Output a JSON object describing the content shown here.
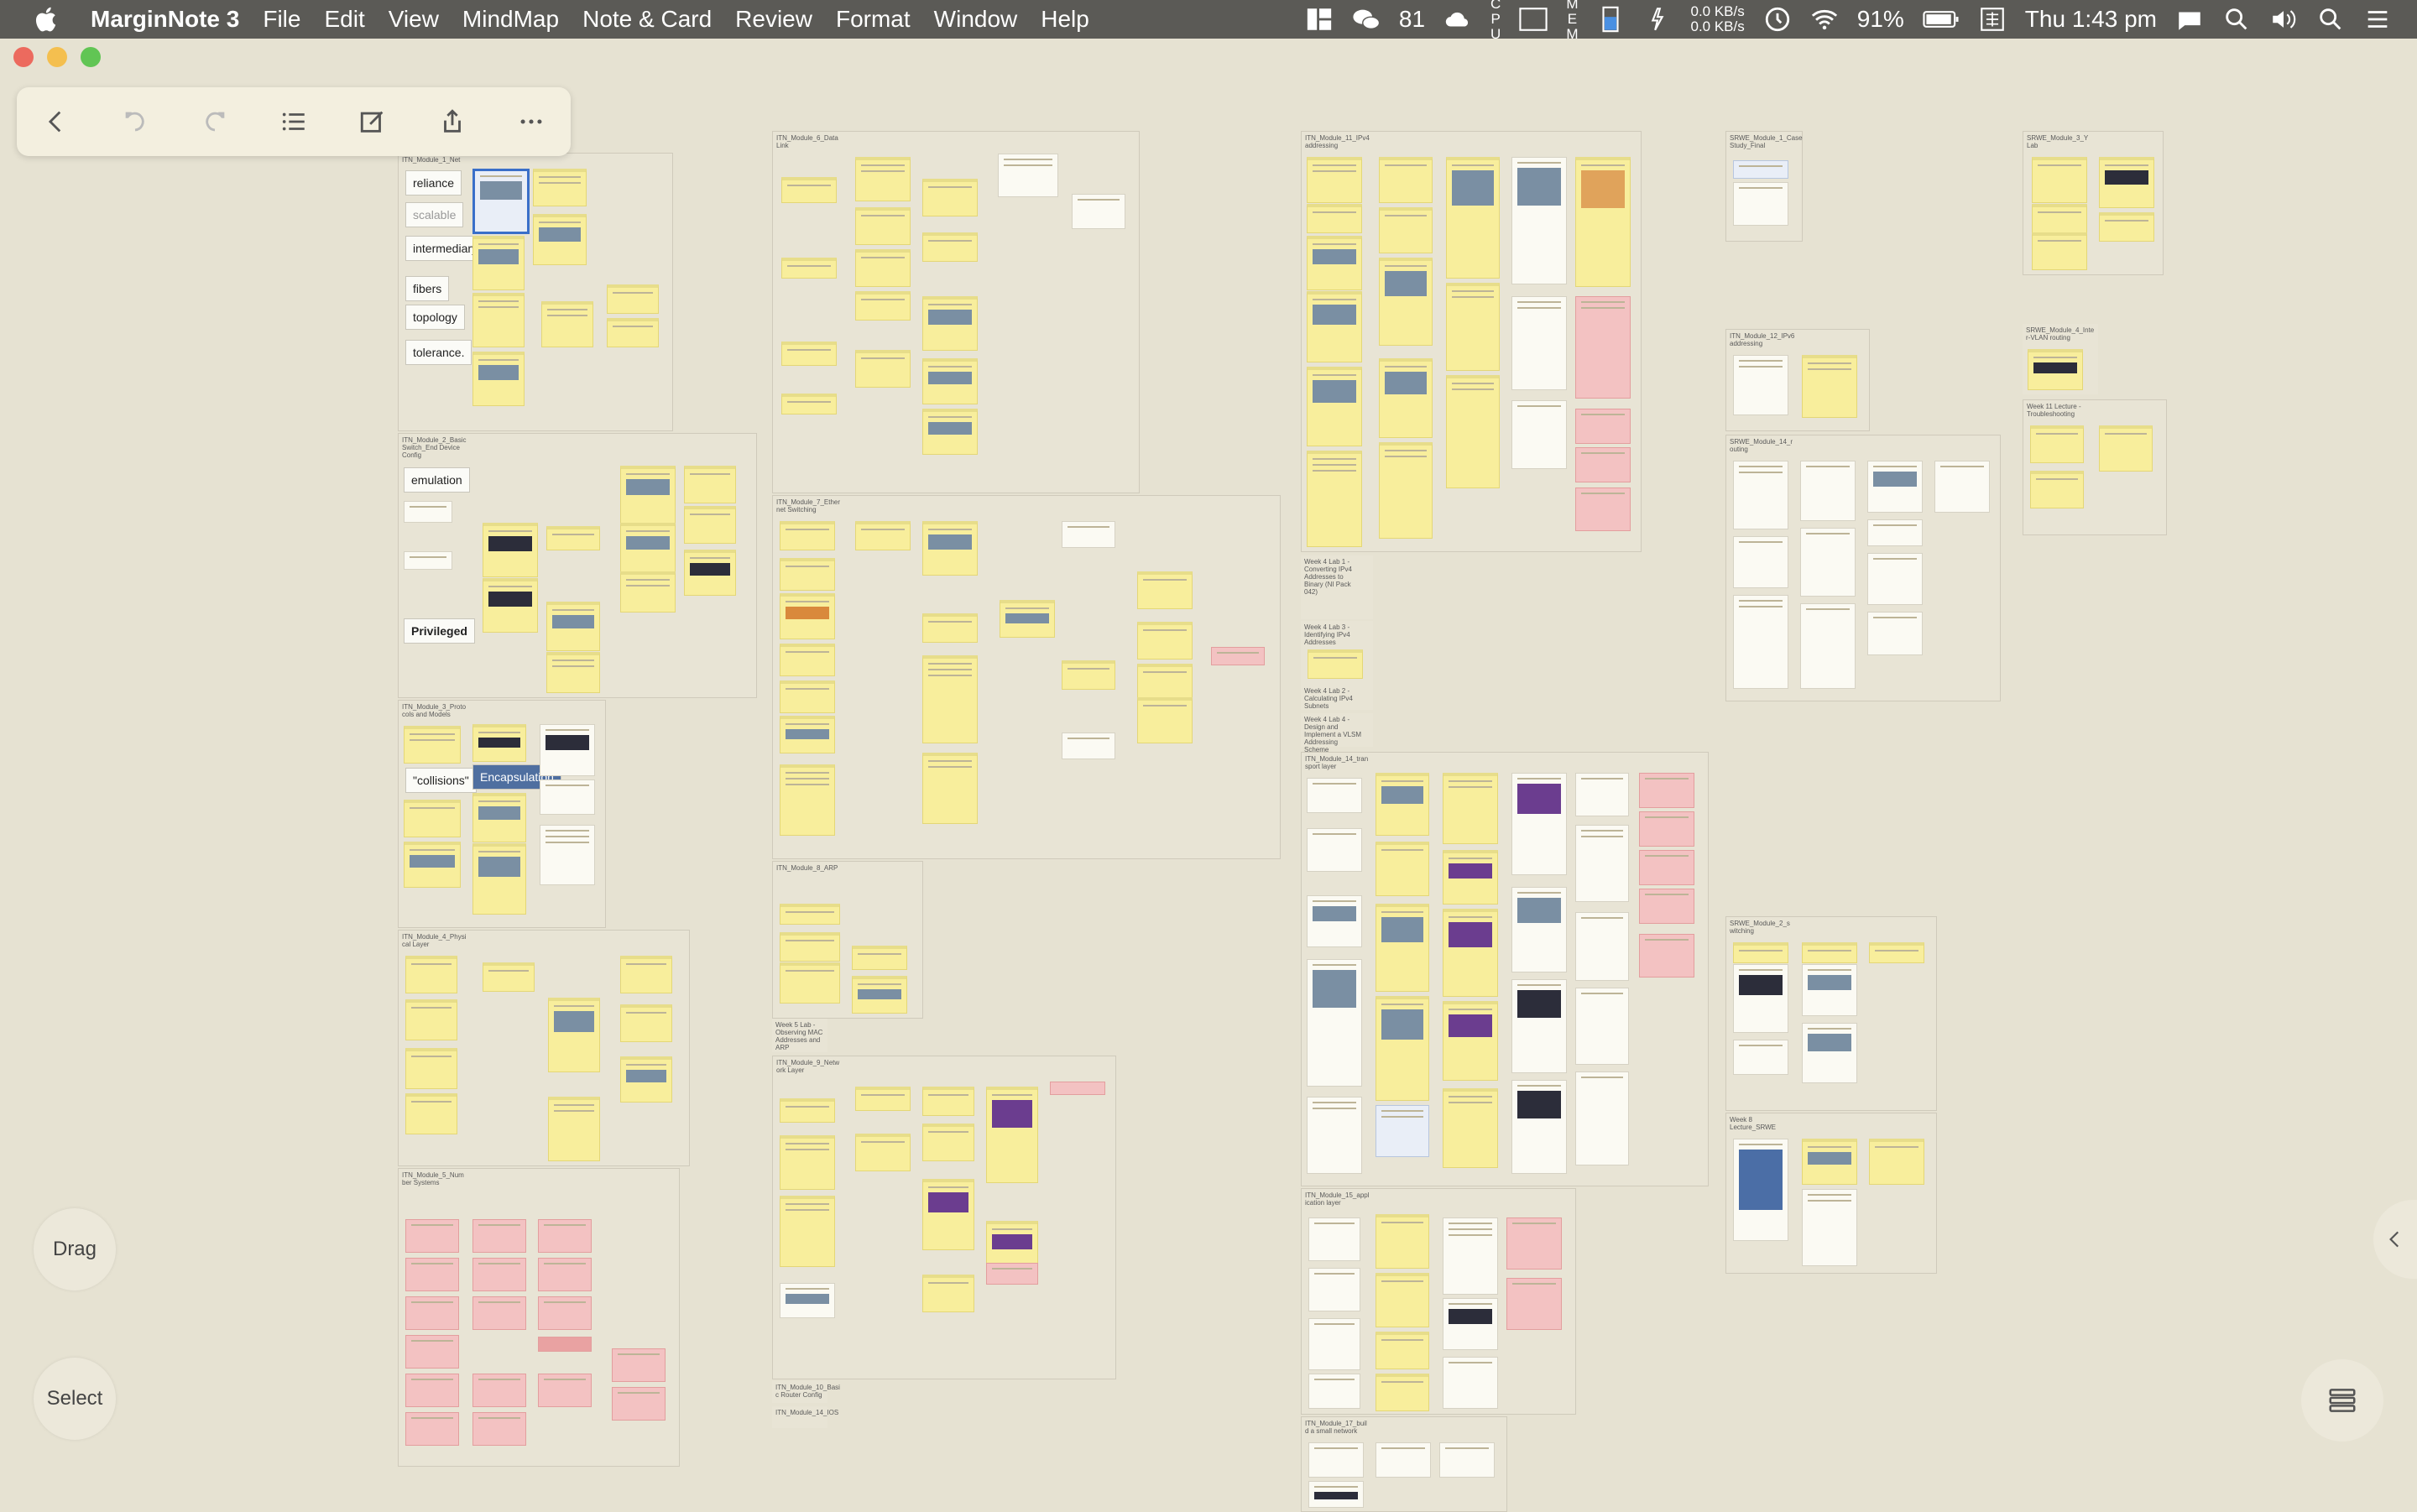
{
  "menubar": {
    "app_name": "MarginNote 3",
    "items": [
      "File",
      "Edit",
      "View",
      "MindMap",
      "Note & Card",
      "Review",
      "Format",
      "Window",
      "Help"
    ],
    "status": {
      "wechat_count": "81",
      "cpu_label": "C\nP\nU",
      "mem_label": "M\nE\nM",
      "net_up": "0.0 KB/s",
      "net_down": "0.0 KB/s",
      "battery": "91%",
      "clock": "Thu 1:43 pm"
    }
  },
  "window_buttons": {
    "close": "#ec6a5e",
    "minimize": "#f4bf4f",
    "zoom": "#61c554"
  },
  "toolbar": {
    "icons": [
      "back-icon",
      "undo-icon",
      "redo-icon",
      "outline-list-icon",
      "edit-icon",
      "share-icon",
      "more-icon"
    ]
  },
  "side": {
    "drag_label": "Drag",
    "select_label": "Select"
  },
  "mindmap": {
    "groups": [
      {
        "label": "ITN_Module_1_Net"
      },
      {
        "label": "ITN_Module_2_Basic Switch_End Device Config"
      },
      {
        "label": "ITN_Module_3_Proto cols and Models"
      },
      {
        "label": "ITN_Module_4_Physi cal Layer"
      },
      {
        "label": "ITN_Module_5_Num ber Systems"
      },
      {
        "label": "ITN_Module_6_Data Link"
      },
      {
        "label": "ITN_Module_7_Ether net Switching"
      },
      {
        "label": "ITN_Module_8_ARP"
      },
      {
        "label": "Week 5 Lab - Observing MAC Addresses and ARP"
      },
      {
        "label": "ITN_Module_9_Netw ork Layer"
      },
      {
        "label": "ITN_Module_10_Basi c Router Config"
      },
      {
        "label": "ITN_Module_14_IOS"
      },
      {
        "label": "ITN_Module_11_IPv4 addressing"
      },
      {
        "label": "Week 4 Lab 1 - Converting IPv4 Addresses to Binary (NI Pack 042)"
      },
      {
        "label": "Week 4 Lab 3 - Identifying IPv4 Addresses"
      },
      {
        "label": "Week 4 Lab 2 - Calculating IPv4 Subnets"
      },
      {
        "label": "Week 4 Lab 4 - Design and Implement a VLSM Addressing Scheme"
      },
      {
        "label": "ITN_Module_14_tran sport layer"
      },
      {
        "label": "ITN_Module_15_appl ication layer"
      },
      {
        "label": "ITN_Module_17_buil d a small network"
      },
      {
        "label": "SRWE_Module_1_Case Study_Final"
      },
      {
        "label": "SRWE_Module_3_Y Lab"
      },
      {
        "label": "ITN_Module_12_IPv6 addressing"
      },
      {
        "label": "SRWE_Module_14_r outing"
      },
      {
        "label": "SRWE_Module_4_Inte r-VLAN routing"
      },
      {
        "label": "Week 11 Lecture - Troubleshooting"
      },
      {
        "label": "SRWE_Module_2_s witching"
      },
      {
        "label": "Week 8 Lecture_SRWE"
      }
    ],
    "keywords": [
      "reliance",
      "scalable",
      "intermediary",
      "fibers",
      "topology",
      "tolerance.",
      "emulation",
      "Privileged",
      "\"collisions\"",
      "Encapsulation"
    ]
  }
}
